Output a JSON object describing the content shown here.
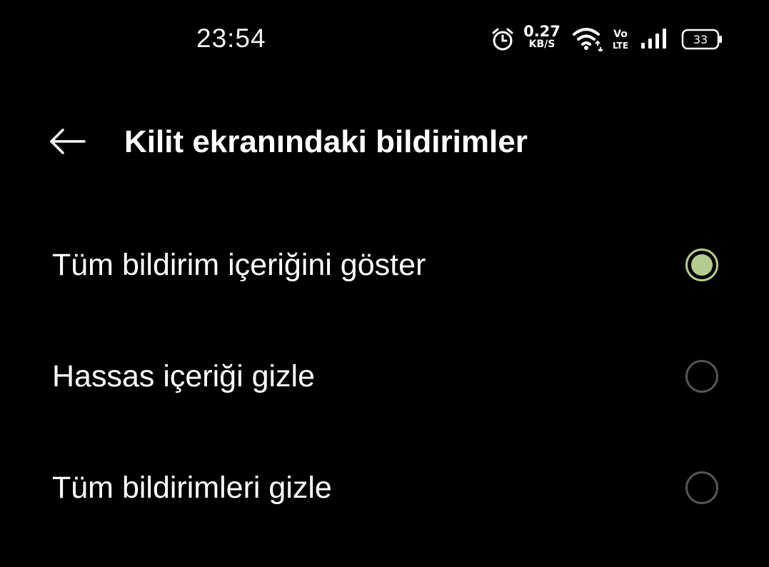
{
  "status_bar": {
    "time": "23:54",
    "network_speed_value": "0.27",
    "network_speed_unit": "KB/S",
    "volte_top": "Vo",
    "volte_bottom": "LTE",
    "battery_level": "33",
    "icons": [
      "alarm-icon",
      "wifi-icon",
      "volte-icon",
      "signal-icon",
      "battery-icon"
    ]
  },
  "header": {
    "back_icon": "arrow-left-icon",
    "title": "Kilit ekranındaki bildirimler"
  },
  "options": [
    {
      "label": "Tüm bildirim içeriğini göster",
      "selected": true
    },
    {
      "label": "Hassas içeriği gizle",
      "selected": false
    },
    {
      "label": "Tüm bildirimleri gizle",
      "selected": false
    }
  ],
  "colors": {
    "background": "#000000",
    "text": "#ffffff",
    "accent": "#b4cc90",
    "radio_unselected": "#555555"
  }
}
